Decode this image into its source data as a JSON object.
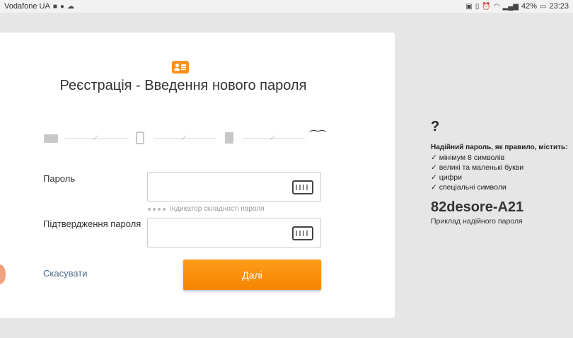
{
  "status_bar": {
    "carrier": "Vodafone UA",
    "battery": "42%",
    "time": "23:23"
  },
  "form": {
    "title": "Реєстрація - Введення нового пароля",
    "password_label": "Пароль",
    "strength_indicator": "Індикатор складності пароля",
    "confirm_label": "Підтвердження пароля",
    "cancel_label": "Скасувати",
    "next_label": "Далі"
  },
  "tips": {
    "question": "?",
    "heading": "Надійний пароль, як правило, містить:",
    "items": [
      "мінімум 8 символів",
      "великі та маленькі букви",
      "цифри",
      "спеціальні символи"
    ],
    "example": "82desore-A21",
    "example_caption": "Приклад надійного пароля"
  },
  "colors": {
    "accent": "#f58400",
    "background": "#e6e6e6"
  }
}
